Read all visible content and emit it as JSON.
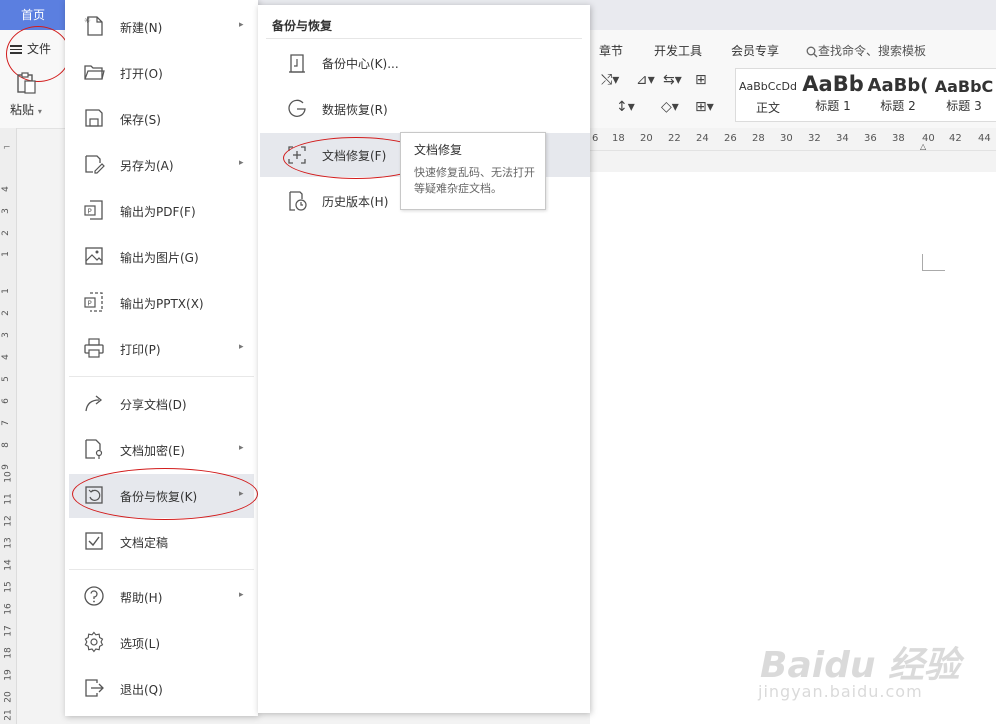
{
  "top": {
    "home_tab": "首页",
    "file_button": "文件"
  },
  "ribbon": {
    "paste_label": "粘贴",
    "tabs": [
      "章节",
      "开发工具",
      "会员专享"
    ],
    "search_placeholder": "查找命令、搜索模板",
    "styles": [
      {
        "preview": "AaBbCcDd",
        "name": "正文"
      },
      {
        "preview": "AaBb",
        "name": "标题 1"
      },
      {
        "preview": "AaBb(",
        "name": "标题 2"
      },
      {
        "preview": "AaBbC",
        "name": "标题 3"
      }
    ]
  },
  "ruler": {
    "top_numbers": [
      "6",
      "18",
      "20",
      "22",
      "24",
      "26",
      "28",
      "30",
      "32",
      "34",
      "36",
      "38",
      "40",
      "42",
      "44"
    ],
    "left_numbers": [
      "4",
      "3",
      "2",
      "1",
      "1",
      "2",
      "3",
      "4",
      "5",
      "6",
      "7",
      "8",
      "9",
      "10",
      "11",
      "12",
      "13",
      "14",
      "15",
      "16",
      "17",
      "18",
      "19",
      "20",
      "21"
    ]
  },
  "file_menu": {
    "items": [
      {
        "label": "新建(N)",
        "icon": "new-file-icon",
        "arrow": "▸"
      },
      {
        "label": "打开(O)",
        "icon": "folder-open-icon"
      },
      {
        "label": "保存(S)",
        "icon": "save-icon"
      },
      {
        "label": "另存为(A)",
        "icon": "save-as-icon",
        "arrow": "▸"
      },
      {
        "label": "输出为PDF(F)",
        "icon": "pdf-export-icon"
      },
      {
        "label": "输出为图片(G)",
        "icon": "image-export-icon"
      },
      {
        "label": "输出为PPTX(X)",
        "icon": "pptx-export-icon"
      },
      {
        "label": "打印(P)",
        "icon": "printer-icon",
        "arrow": "▸"
      },
      {
        "label": "分享文档(D)",
        "icon": "share-icon"
      },
      {
        "label": "文档加密(E)",
        "icon": "encrypt-icon",
        "arrow": "▸"
      },
      {
        "label": "备份与恢复(K)",
        "icon": "backup-restore-icon",
        "arrow": "▸"
      },
      {
        "label": "文档定稿",
        "icon": "finalize-icon"
      },
      {
        "label": "帮助(H)",
        "icon": "help-icon",
        "arrow": "▸"
      },
      {
        "label": "选项(L)",
        "icon": "gear-icon"
      },
      {
        "label": "退出(Q)",
        "icon": "exit-icon"
      }
    ]
  },
  "sub_menu": {
    "title": "备份与恢复",
    "items": [
      {
        "label": "备份中心(K)...",
        "icon": "backup-center-icon"
      },
      {
        "label": "数据恢复(R)",
        "icon": "data-recovery-icon"
      },
      {
        "label": "文档修复(F)",
        "icon": "doc-repair-icon"
      },
      {
        "label": "历史版本(H)",
        "icon": "history-version-icon"
      }
    ]
  },
  "tooltip": {
    "title": "文档修复",
    "body": "快速修复乱码、无法打开等疑难杂症文档。"
  },
  "watermark": {
    "logo": "Baidu 经验",
    "url": "jingyan.baidu.com"
  },
  "colors": {
    "accent": "#5b7fe0",
    "annotation": "#d21c1c",
    "menu_hover": "#e6e8ed"
  }
}
